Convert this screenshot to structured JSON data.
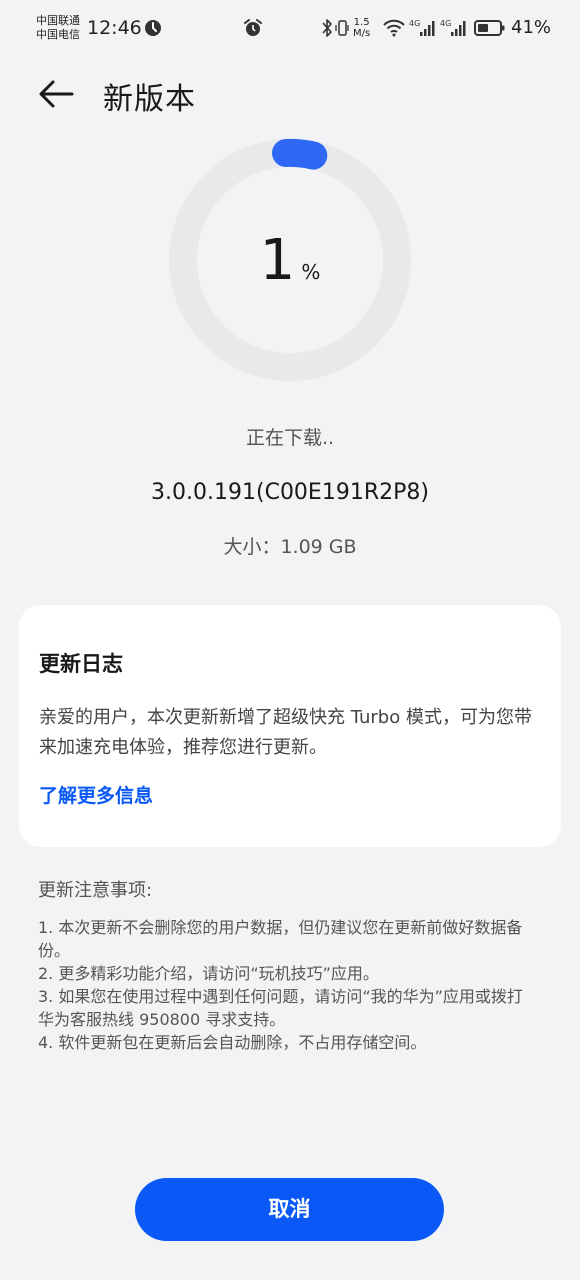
{
  "status_bar": {
    "carrier_1": "中国联通",
    "carrier_2": "中国电信",
    "time": "12:46",
    "net_speed_value": "1.5",
    "net_speed_unit": "M/s",
    "battery_percent": "41%",
    "icons": [
      "do-not-disturb-icon",
      "alarm-icon",
      "bluetooth-icon",
      "vibrate-icon",
      "wifi-icon",
      "signal-4g-icon",
      "signal-4g-icon",
      "battery-icon"
    ]
  },
  "header": {
    "title": "新版本"
  },
  "progress": {
    "value": "1",
    "unit": "%",
    "fraction": 0.01,
    "ring_color": "#e8e9eb",
    "indicator_color": "#2f68f5"
  },
  "download": {
    "status": "正在下载..",
    "version": "3.0.0.191(C00E191R2P8)",
    "size": "大小：1.09 GB"
  },
  "changelog": {
    "title": "更新日志",
    "body": "亲爱的用户，本次更新新增了超级快充 Turbo 模式，可为您带来加速充电体验，推荐您进行更新。",
    "link": "了解更多信息"
  },
  "notes": {
    "title": "更新注意事项:",
    "items": [
      "1. 本次更新不会删除您的用户数据，但仍建议您在更新前做好数据备份。",
      "2. 更多精彩功能介绍，请访问“玩机技巧”应用。",
      "3. 如果您在使用过程中遇到任何问题，请访问“我的华为”应用或拨打华为客服热线 950800 寻求支持。",
      "4. 软件更新包在更新后会自动删除，不占用存储空间。"
    ]
  },
  "actions": {
    "cancel": "取消"
  },
  "colors": {
    "accent": "#0a59f7",
    "background": "#f1f3f5",
    "card": "#ffffff"
  }
}
